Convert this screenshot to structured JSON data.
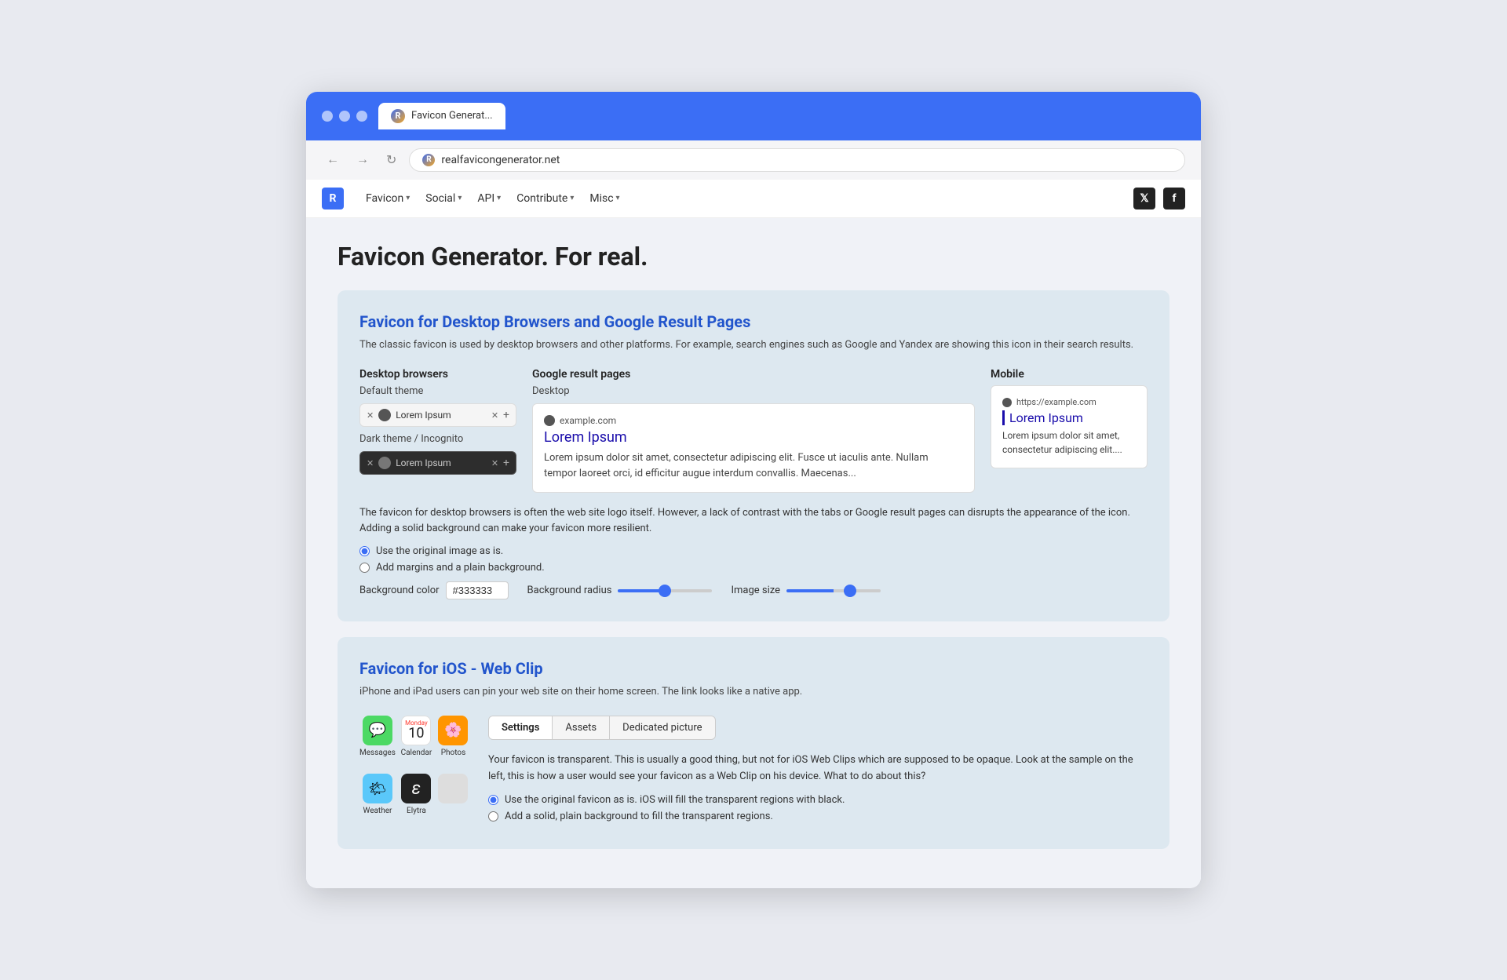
{
  "browser": {
    "tab_label": "Favicon Generat...",
    "url": "realfavicongenerator.net"
  },
  "navbar": {
    "brand": "R",
    "links": [
      {
        "label": "Favicon",
        "has_caret": true
      },
      {
        "label": "Social",
        "has_caret": true
      },
      {
        "label": "API",
        "has_caret": true
      },
      {
        "label": "Contribute",
        "has_caret": true
      },
      {
        "label": "Misc",
        "has_caret": true
      }
    ]
  },
  "page": {
    "title": "Favicon Generator. For real."
  },
  "desktop_section": {
    "title": "Favicon for Desktop Browsers and Google Result Pages",
    "description": "The classic favicon is used by desktop browsers and other platforms. For example, search engines such as Google and Yandex are showing this icon in their search results.",
    "desktop_browsers_label": "Desktop browsers",
    "default_theme_label": "Default theme",
    "tab_text": "Lorem Ipsum",
    "dark_theme_label": "Dark theme / Incognito",
    "dark_tab_text": "Lorem Ipsum",
    "google_label": "Google result pages",
    "desktop_label": "Desktop",
    "mobile_label": "Mobile",
    "google_url": "example.com",
    "google_link": "Lorem Ipsum",
    "google_snippet": "Lorem ipsum dolor sit amet, consectetur adipiscing elit. Fusce ut iaculis ante. Nullam tempor laoreet orci, id efficitur augue interdum convallis. Maecenas...",
    "mobile_url": "https://example.com",
    "mobile_link": "Lorem Ipsum",
    "mobile_snippet": "Lorem ipsum dolor sit amet, consectetur adipiscing elit....",
    "options_desc": "The favicon for desktop browsers is often the web site logo itself. However, a lack of contrast with the tabs or Google result pages can disrupts the appearance of the icon. Adding a solid background can make your favicon more resilient.",
    "radio1": "Use the original image as is.",
    "radio2": "Add margins and a plain background.",
    "bg_color_label": "Background color",
    "bg_color_value": "#333333",
    "bg_radius_label": "Background radius",
    "img_size_label": "Image size"
  },
  "ios_section": {
    "title": "Favicon for iOS - Web Clip",
    "description": "iPhone and iPad users can pin your web site on their home screen. The link looks like a native app.",
    "tabs": [
      "Settings",
      "Assets",
      "Dedicated picture"
    ],
    "active_tab": "Settings",
    "ios_desc": "Your favicon is transparent. This is usually a good thing, but not for iOS Web Clips which are supposed to be opaque. Look at the sample on the left, this is how a user would see your favicon as a Web Clip on his device. What to do about this?",
    "ios_radio1": "Use the original favicon as is. iOS will fill the transparent regions with black.",
    "ios_radio2": "Add a solid, plain background to fill the transparent regions.",
    "app_icons": [
      {
        "label": "Messages",
        "emoji": "💬",
        "color": "green"
      },
      {
        "label": "Calendar",
        "emoji": "📅",
        "color": "white"
      },
      {
        "label": "Photos",
        "emoji": "🌸",
        "color": "orange"
      },
      {
        "label": "Weather",
        "emoji": "🌤",
        "color": "blue"
      },
      {
        "label": "Elytra",
        "emoji": "ε",
        "color": "dark"
      },
      {
        "label": "",
        "emoji": "",
        "color": "placeholder"
      }
    ]
  }
}
